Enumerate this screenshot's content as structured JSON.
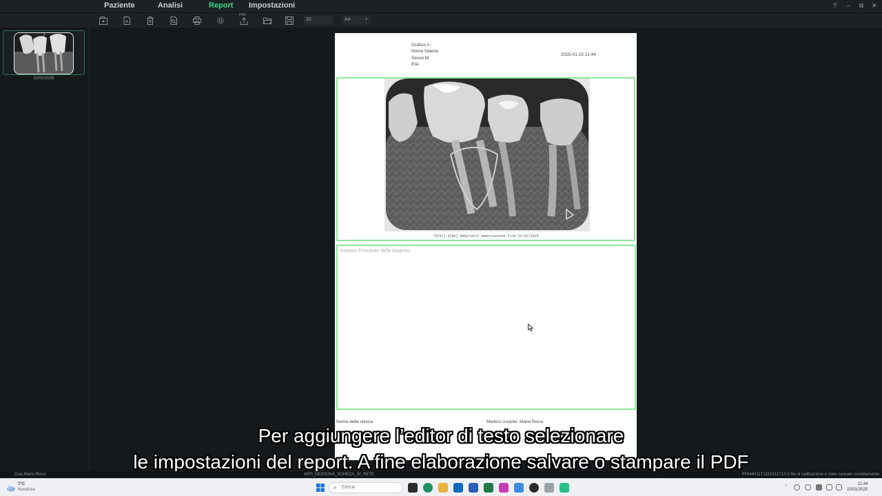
{
  "menu": {
    "items": [
      {
        "label": "Paziente",
        "active": false
      },
      {
        "label": "Analisi",
        "active": false
      },
      {
        "label": "Report",
        "active": true
      },
      {
        "label": "Impostazioni",
        "active": false
      }
    ],
    "window_controls": [
      "?",
      "–",
      "⧉",
      "✕"
    ]
  },
  "toolbar": {
    "icons": [
      "new-report-icon",
      "add-page-icon",
      "delete-icon",
      "preview-icon",
      "print-icon",
      "settings-icon",
      "export-pdf-icon",
      "open-folder-icon",
      "save-icon"
    ],
    "pdf_label": "PDF",
    "font_size_value": "20",
    "paper_size_value": "A4"
  },
  "sidebar": {
    "thumbnail_date": "22/01/2025"
  },
  "report": {
    "chart_label": "Grafico n.:",
    "name_label": "Nome:Valeria",
    "sex_label": "Sesso:M",
    "age_label": "Età:",
    "datetime": "2025-01-22 11:44",
    "image_caption": "75[kV]  3[mA]  0mGy•cm^2  importazione file  22/01/2025",
    "diagnosis_placeholder": "Inserisci il risultato della diagnosi",
    "clinic_label": "Nome della clinica:",
    "doctor_label": "Medico curante: Mario Rossi"
  },
  "subtitles": {
    "line1": "Per aggiungere l’editor di testo selezionare",
    "line2": "le impostazioni del report. A fine elaborazione salvare o stampare il PDF"
  },
  "statusbar": {
    "user": "Ciao,Mario Rossi",
    "wifi": "WIFI_NESSUNA_SCHEDA_DI_RETE",
    "calibration": "PF644011T115231271X,Il file di calibrazione è stato caricato correttamente"
  },
  "taskbar": {
    "weather_temp": "7°C",
    "weather_desc": "Nuvoloso",
    "search_placeholder": "Cerca",
    "clock_time": "11:44",
    "clock_date": "22/01/2025"
  },
  "colors": {
    "accent": "#39d98a",
    "frame_green": "#8ee79a",
    "background": "#15191c"
  }
}
